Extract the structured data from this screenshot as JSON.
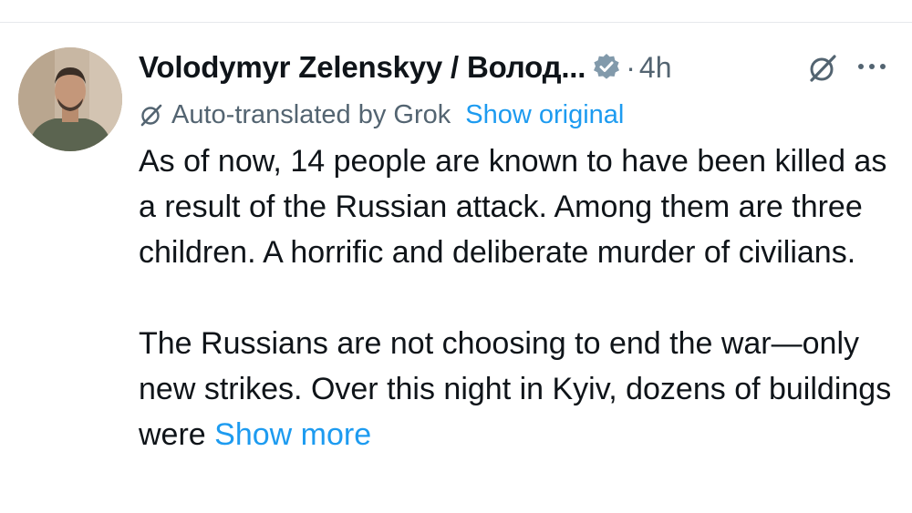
{
  "tweet": {
    "author_name": "Volodymyr Zelenskyy / Волод...",
    "separator": "·",
    "timestamp": "4h",
    "translation_note": "Auto-translated by Grok",
    "show_original_label": "Show original",
    "paragraph_1": "As of now, 14 people are known to have been killed as a result of the Russian attack. Among them are three children. A horrific and deliberate murder of civilians.",
    "paragraph_2": "The Russians are not choosing to end the war—only new strikes. Over this night in Kyiv, dozens of buildings were",
    "show_more_label": "Show more"
  },
  "colors": {
    "text_primary": "#0f1419",
    "text_secondary": "#536471",
    "link_blue": "#1d9bf0",
    "verified_badge": "#829aab"
  },
  "icons": {
    "verified": "verified-badge-icon",
    "grok_header": "grok-icon",
    "more": "more-icon",
    "translate": "grok-translate-icon"
  }
}
